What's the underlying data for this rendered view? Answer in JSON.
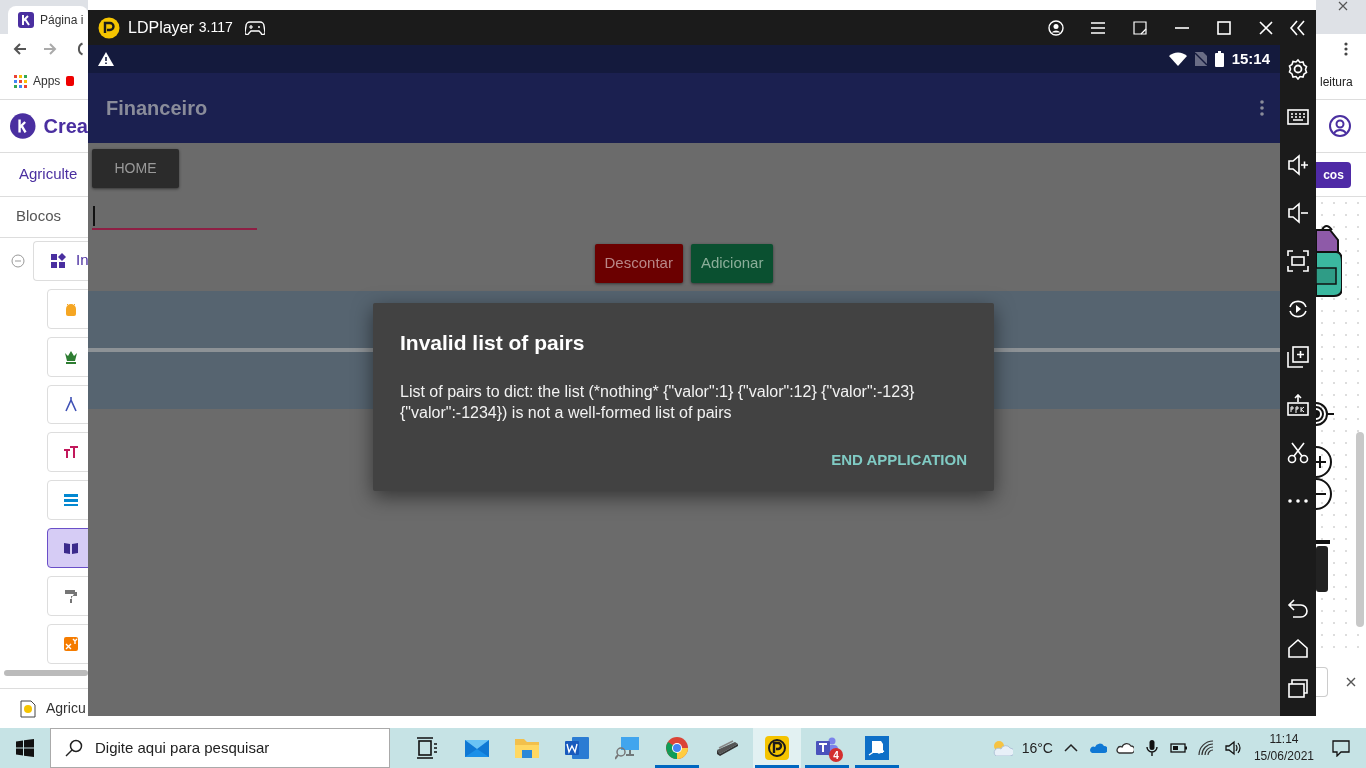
{
  "browser": {
    "tab_title": "Página i",
    "bookmark": "Apps",
    "bookmark_right": "leitura",
    "brand": "Crea",
    "project_tab": "Agriculte",
    "action_button": "cos",
    "section_title": "Blocos",
    "tree_root": {
      "label": "In",
      "expanded": true
    },
    "blocks": [
      {
        "kind": "android",
        "color": "#f5a623",
        "selected": false
      },
      {
        "kind": "chess",
        "color": "#2e7d32",
        "selected": false
      },
      {
        "kind": "compass",
        "color": "#3f51b5",
        "selected": false
      },
      {
        "kind": "text",
        "color": "#c2185b",
        "selected": false
      },
      {
        "kind": "layout",
        "color": "#0288d1",
        "selected": false
      },
      {
        "kind": "book",
        "color": "#3b2a8c",
        "selected": true
      },
      {
        "kind": "roller",
        "color": "#757575",
        "selected": false
      },
      {
        "kind": "power",
        "color": "#f57c00",
        "selected": false
      }
    ],
    "download": "Agricu"
  },
  "emulator": {
    "title": "LDPlayer",
    "version": "3.117",
    "clock": "15:14",
    "app_title": "Financeiro",
    "home_button": "HOME",
    "buttons": [
      {
        "label": "Descontar",
        "kind": "danger"
      },
      {
        "label": "Adicionar",
        "kind": "success"
      }
    ],
    "dialog": {
      "title": "Invalid list of pairs",
      "message": "List of pairs to dict: the list (*nothing* {\"valor\":1} {\"valor\":12} {\"valor\":-123} {\"valor\":-1234}) is not a well-formed list of pairs",
      "action": "END APPLICATION"
    }
  },
  "taskbar": {
    "search_placeholder": "Digite aqui para pesquisar",
    "apps": [
      {
        "kind": "taskview",
        "running": false,
        "selected": false
      },
      {
        "kind": "mail",
        "running": false,
        "selected": false
      },
      {
        "kind": "explorer",
        "running": false,
        "selected": false
      },
      {
        "kind": "word",
        "running": false,
        "selected": false
      },
      {
        "kind": "remote",
        "running": false,
        "selected": false
      },
      {
        "kind": "chrome",
        "running": true,
        "selected": false
      },
      {
        "kind": "scanner",
        "running": false,
        "selected": false
      },
      {
        "kind": "ldplayer",
        "running": true,
        "selected": true
      },
      {
        "kind": "teams",
        "running": true,
        "selected": false,
        "badge": "4"
      },
      {
        "kind": "board",
        "running": true,
        "selected": false
      }
    ],
    "temperature": "16°C",
    "time": "11:14",
    "date": "15/06/2021"
  }
}
